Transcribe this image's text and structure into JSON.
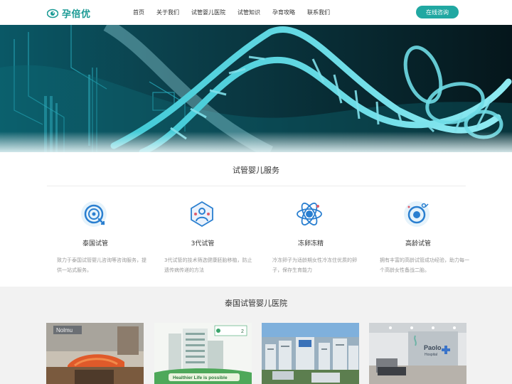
{
  "header": {
    "logo_text": "孕倍优",
    "nav": [
      "首页",
      "关于我们",
      "试管婴儿医院",
      "试管知识",
      "孕育攻略",
      "联系我们"
    ],
    "cta_label": "在线咨询"
  },
  "colors": {
    "brand": "#21a8a2",
    "text": "#333333",
    "muted": "#999999",
    "section_bg": "#f2f2f2"
  },
  "services": {
    "title": "试管婴儿服务",
    "items": [
      {
        "icon": "target-icon",
        "name": "泰国试管",
        "desc": "致力于泰国试管婴儿咨询等咨询服务，提供一站式服务。"
      },
      {
        "icon": "genetics-icon",
        "name": "3代试管",
        "desc": "3代试管的技术筛选健康胚胎移植，防止遗传病传递的方法"
      },
      {
        "icon": "atom-icon",
        "name": "冻卵冻精",
        "desc": "冷冻卵子为适龄期女性冷冻住优质的卵子，保存生育能力"
      },
      {
        "icon": "fertility-icon",
        "name": "高龄试管",
        "desc": "拥有丰富的高龄试管成功经验，助力每一个高龄女性备战二胎。"
      }
    ]
  },
  "hospitals": {
    "title": "泰国试管婴儿医院",
    "cards": [
      {
        "photo": "hospital-entrance-photo",
        "sign": "Nolmu"
      },
      {
        "photo": "hospital-building-photo",
        "badge": "2",
        "slogan": "Healthier Life is possible"
      },
      {
        "photo": "city-skyline-photo"
      },
      {
        "photo": "clinic-lobby-photo",
        "sign_line1": "Paolo",
        "sign_line2": "Hospital"
      }
    ]
  }
}
